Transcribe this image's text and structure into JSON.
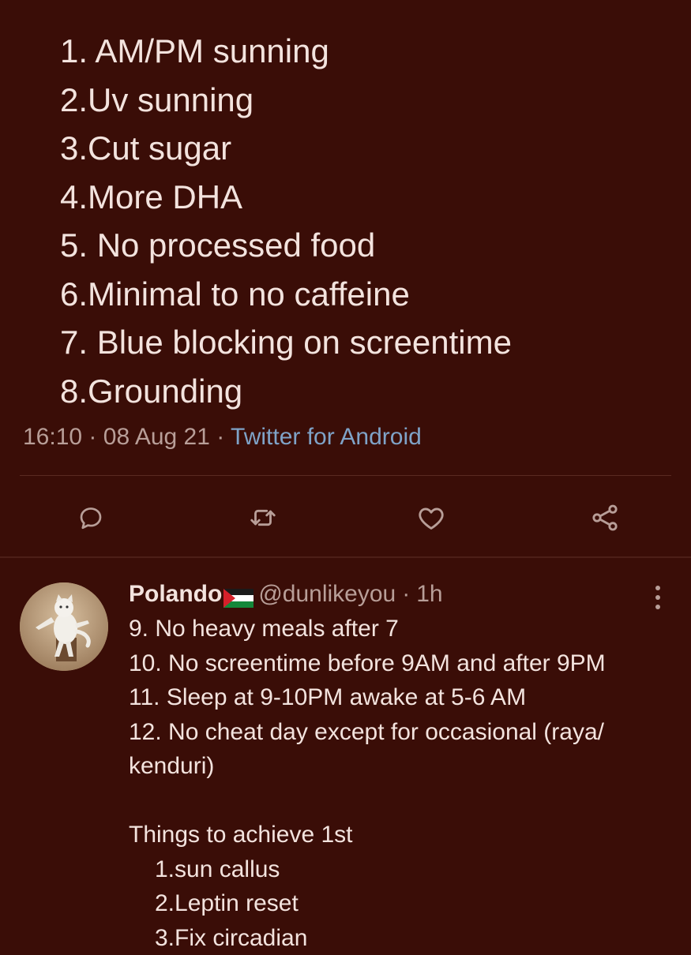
{
  "main_tweet": {
    "lines": [
      "1. AM/PM sunning",
      "2.Uv sunning",
      "3.Cut sugar",
      "4.More DHA",
      "5. No processed food",
      "6.Minimal to no caffeine",
      "7. Blue blocking on screentime",
      "8.Grounding"
    ],
    "time": "16:10",
    "date": "08 Aug 21",
    "separator": "·",
    "source": "Twitter for Android"
  },
  "actions": {
    "icons": [
      "reply-icon",
      "retweet-icon",
      "like-icon",
      "share-icon"
    ]
  },
  "reply": {
    "display_name": "Polando",
    "flag": "palestine-flag",
    "handle": "@dunlikeyou",
    "separator": "·",
    "time": "1h",
    "lines": [
      "9. No heavy meals after 7",
      "10. No screentime before 9AM and after 9PM",
      "11. Sleep at 9-10PM awake at 5-6 AM",
      "12. No cheat day except for occasional (raya/",
      "kenduri)",
      "",
      "Things to achieve 1st",
      "1.sun callus",
      "2.Leptin reset",
      "3.Fix circadian"
    ]
  },
  "colors": {
    "background": "#3a0d07",
    "text": "#f3e3de",
    "muted": "#b89e98",
    "link": "#7fa3c8"
  }
}
